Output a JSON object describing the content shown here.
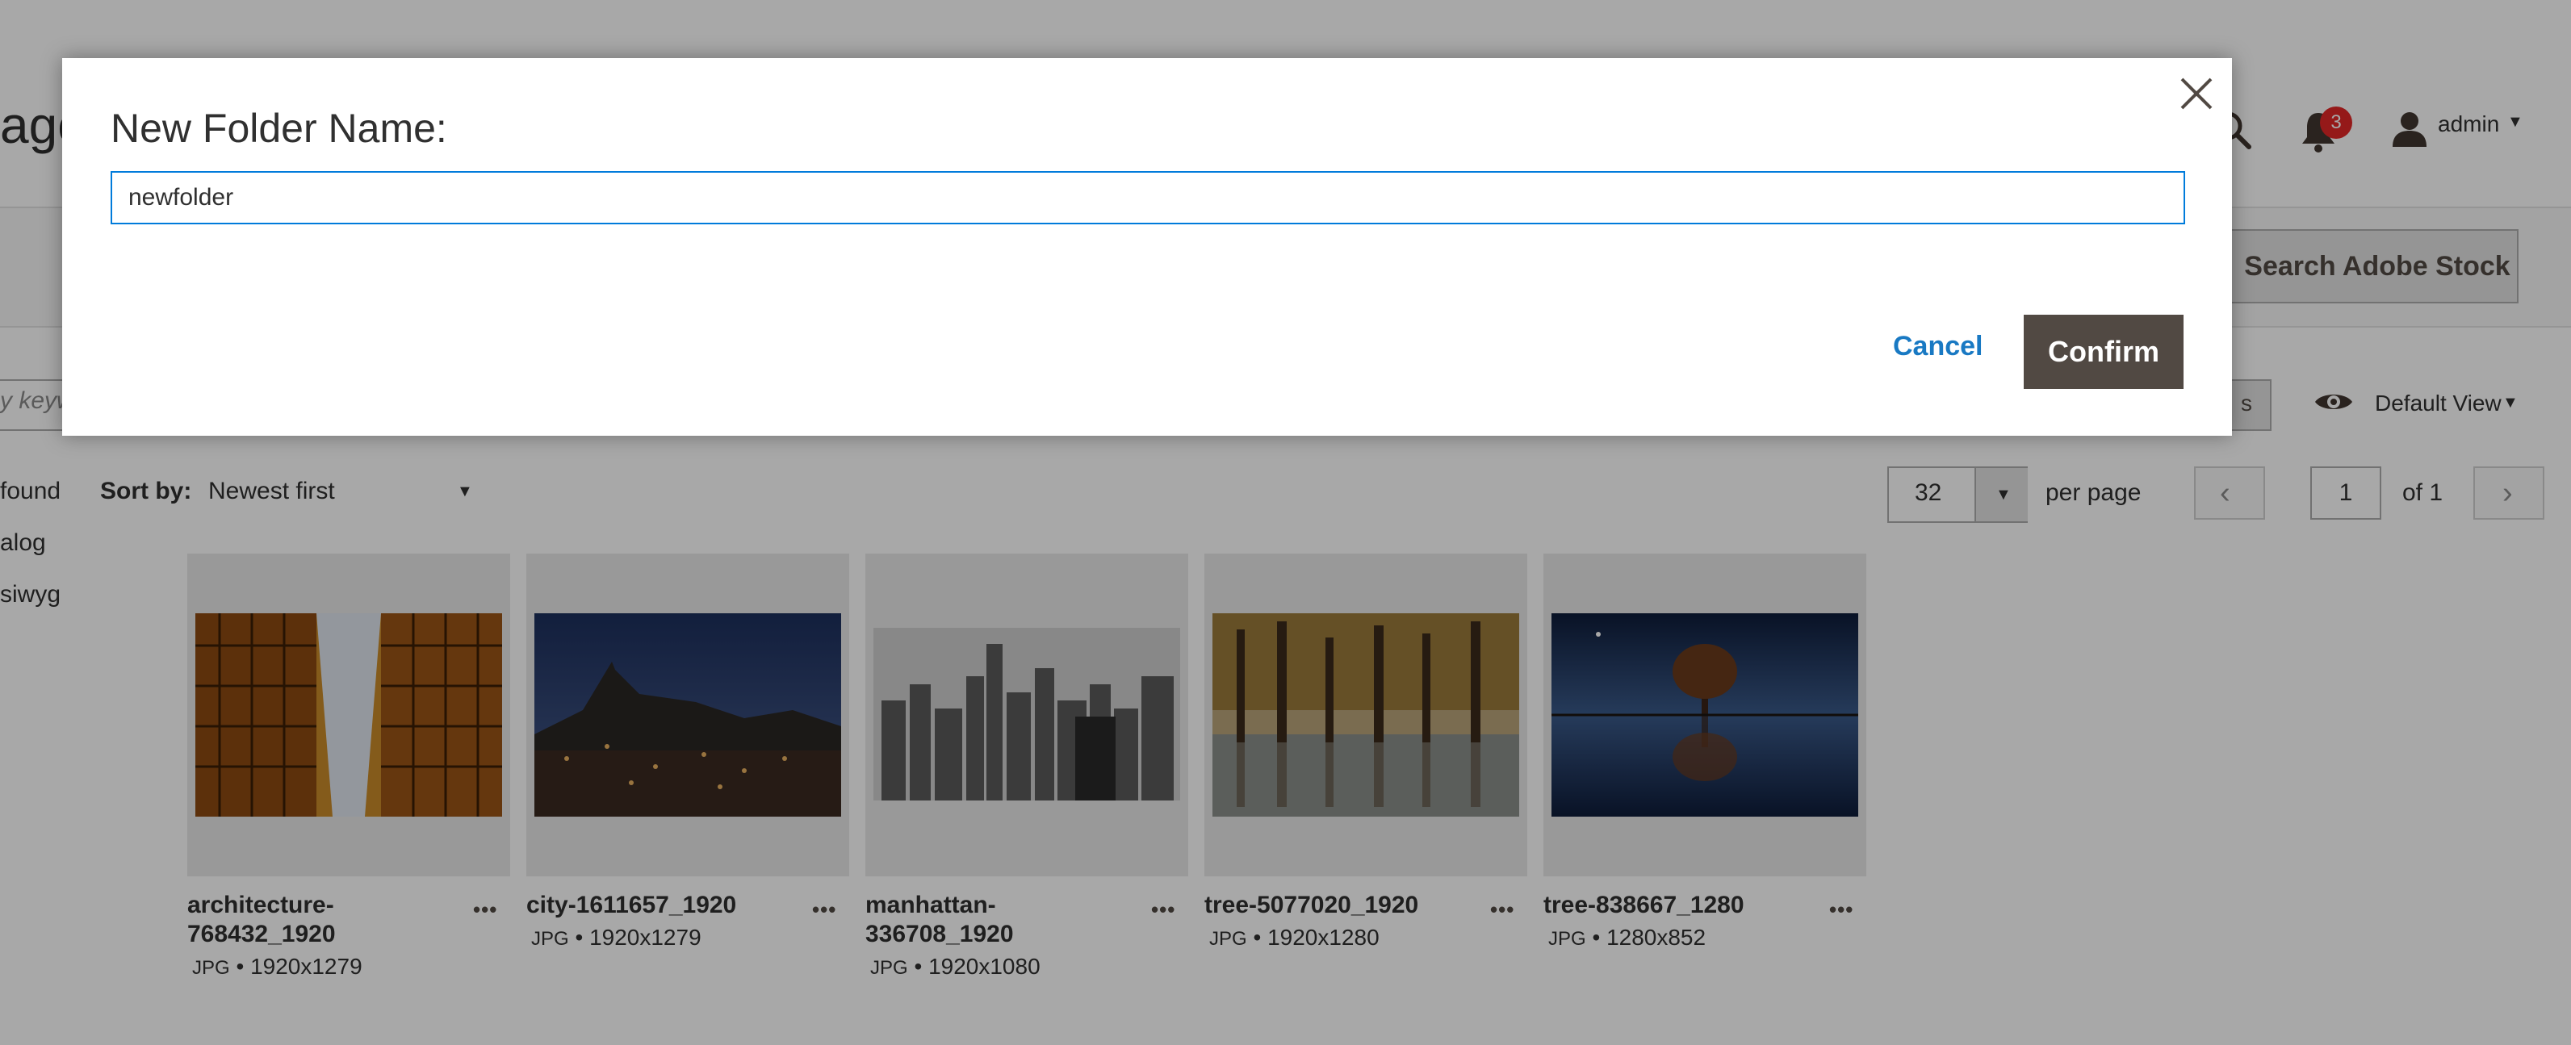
{
  "header": {
    "page_title_fragment": "age",
    "notification_count": "3",
    "user_name": "admin"
  },
  "toolbar": {
    "search_stock_label": "Search Adobe Stock"
  },
  "filters": {
    "keyword_placeholder_fragment": "y keyw",
    "filters_button_fragment": "s",
    "view_label": "Default View"
  },
  "listing": {
    "found_fragment": "found",
    "sort_label": "Sort by:",
    "sort_value": "Newest first",
    "per_page_value": "32",
    "per_page_label": "per page",
    "current_page": "1",
    "total_pages_label": "of 1"
  },
  "folder_tree": [
    {
      "label": "alog"
    },
    {
      "label": "siwyg"
    }
  ],
  "images": [
    {
      "name": "architecture-768432_1920",
      "type": "JPG",
      "dimensions": "1920x1279"
    },
    {
      "name": "city-1611657_1920",
      "type": "JPG",
      "dimensions": "1920x1279"
    },
    {
      "name": "manhattan-336708_1920",
      "type": "JPG",
      "dimensions": "1920x1080"
    },
    {
      "name": "tree-5077020_1920",
      "type": "JPG",
      "dimensions": "1920x1280"
    },
    {
      "name": "tree-838667_1280",
      "type": "JPG",
      "dimensions": "1280x852"
    }
  ],
  "modal": {
    "title": "New Folder Name:",
    "input_value": "newfolder",
    "cancel_label": "Cancel",
    "confirm_label": "Confirm"
  },
  "colors": {
    "primary_button": "#514943",
    "link": "#1979c3",
    "focus_border": "#007bdb",
    "badge": "#e22626"
  }
}
